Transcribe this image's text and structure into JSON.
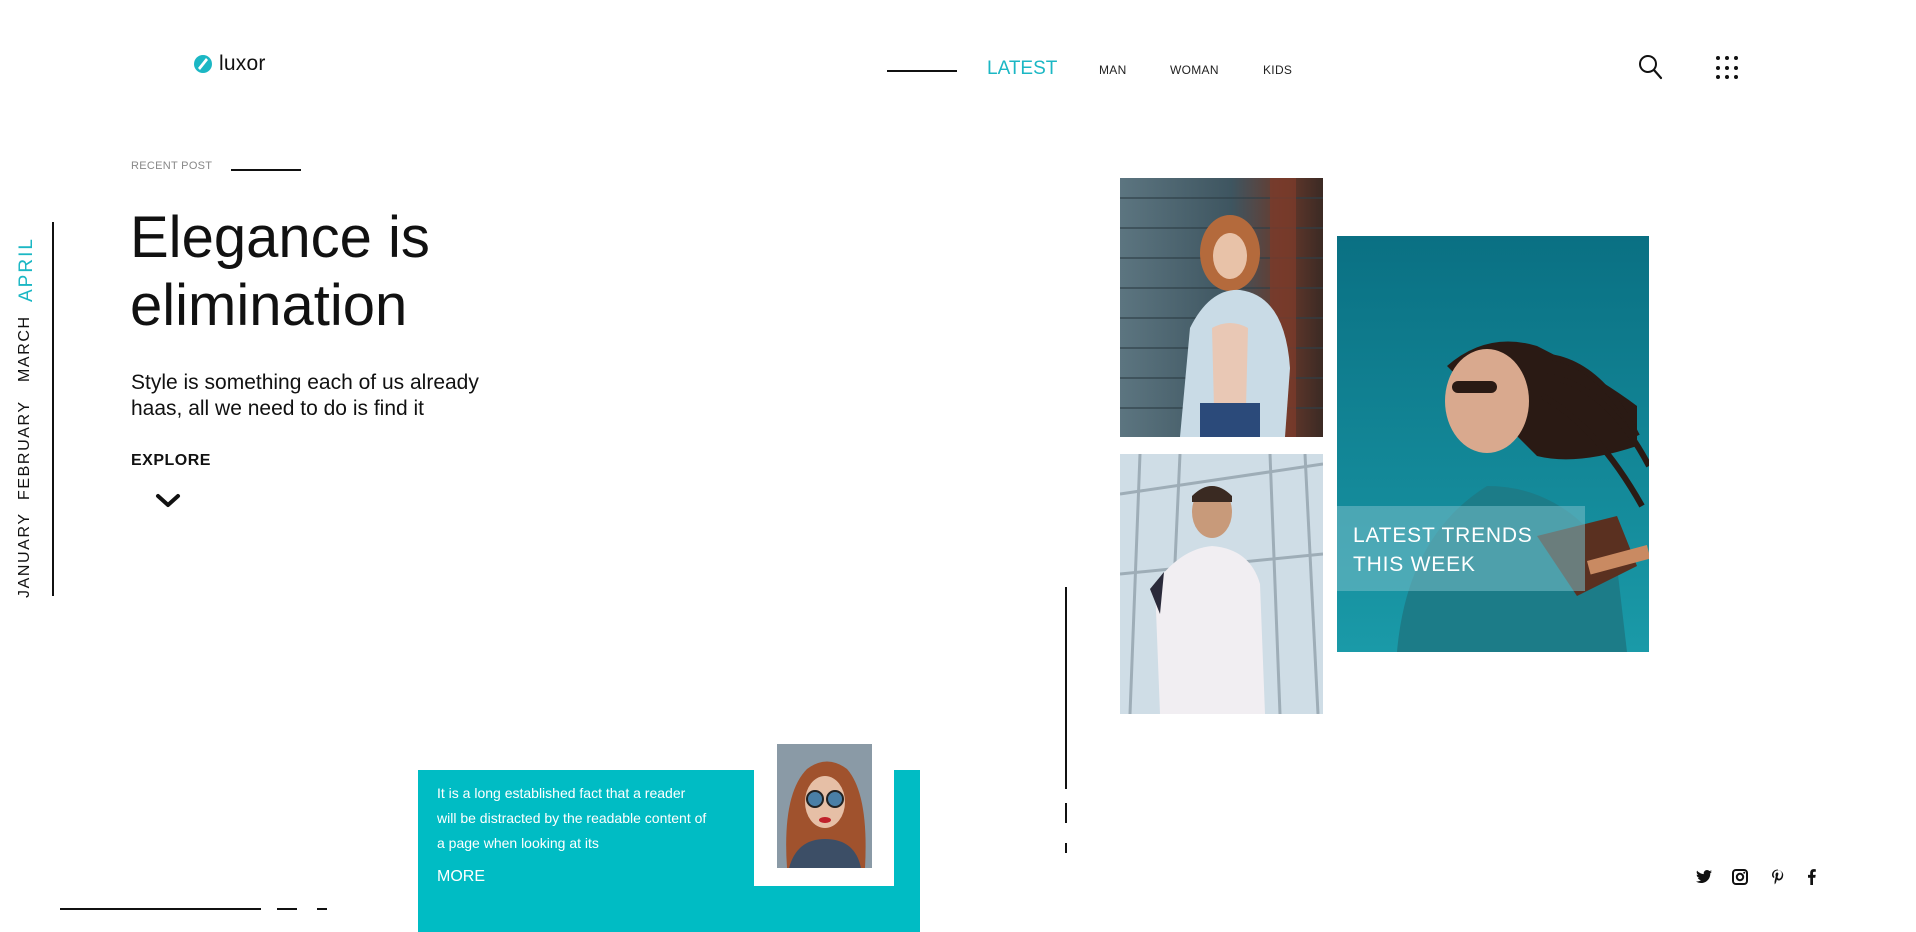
{
  "brand": {
    "name": "luxor",
    "accent": "#1bb7c4",
    "card_color": "#00bcc4"
  },
  "nav": {
    "active": "LATEST",
    "items": [
      "MAN",
      "WOMAN",
      "KIDS"
    ],
    "search_icon": "search-icon",
    "menu_icon": "grid-menu-icon"
  },
  "months": {
    "items": [
      "JANUARY",
      "FEBRUARY",
      "MARCH",
      "APRIL"
    ],
    "active": "APRIL"
  },
  "hero": {
    "recent_label": "RECENT POST",
    "title_line1": "Elegance is",
    "title_line2": "elimination",
    "subtitle_line1": "Style is something each of us already",
    "subtitle_line2": "haas, all we need to do is find it",
    "cta": "EXPLORE"
  },
  "trends": {
    "line1": "LATEST TRENDS",
    "line2": "THIS WEEK"
  },
  "card": {
    "line1": "It is a long established fact that a reader",
    "line2": "will be distracted by the readable content of",
    "line3": "a page when looking at its",
    "more": "MORE"
  },
  "socials": [
    "twitter-icon",
    "instagram-icon",
    "pinterest-icon",
    "facebook-icon"
  ]
}
